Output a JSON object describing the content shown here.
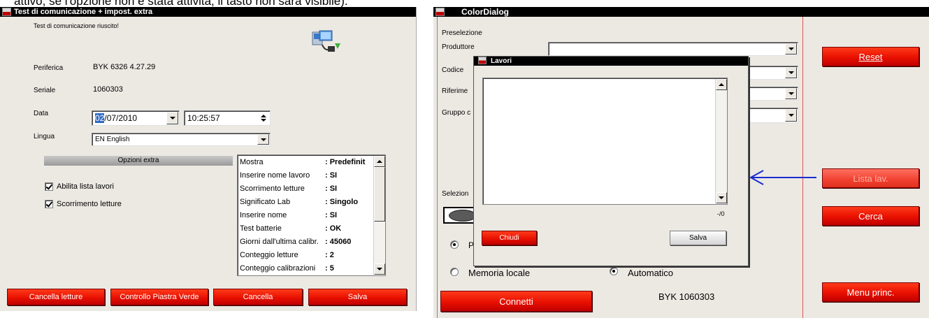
{
  "header_cut_text": "attivo, se l'opzione non è stata attivita, il tasto non sarà visibile).",
  "left": {
    "title": "Test di comunicazione + impost. extra",
    "success_msg": "Test di comunicazione riuscito!",
    "labels": {
      "periferica": "Periferica",
      "seriale": "Seriale",
      "data": "Data",
      "lingua": "Lingua"
    },
    "periferica_value": "BYK 6326 4.27.29",
    "seriale_value": "1060303",
    "date_day": "02",
    "date_rest": "/07/2010",
    "time_value": "10:25:57",
    "language_value": "EN English",
    "extra_header": "Opzioni extra",
    "checkbox_joblist": "Abilita lista lavori",
    "checkbox_scroll": "Scorrimento letture",
    "options": [
      {
        "k": "Mostra",
        "v": ": Predefinit"
      },
      {
        "k": "Inserire nome lavoro",
        "v": ": SI"
      },
      {
        "k": "Scorrimento letture",
        "v": ": SI"
      },
      {
        "k": "Significato Lab",
        "v": ": Singolo"
      },
      {
        "k": "Inserire nome",
        "v": ": SI"
      },
      {
        "k": "Test batterie",
        "v": ": OK"
      },
      {
        "k": "Giorni dall'ultima calibr.",
        "v": ": 45060"
      },
      {
        "k": "Conteggio letture",
        "v": ": 2"
      },
      {
        "k": "Conteggio calibrazioni",
        "v": ": 5"
      }
    ],
    "buttons": {
      "cancel_readings": "Cancella letture",
      "green_tile": "Controllo Piastra Verde",
      "cancel": "Cancella",
      "save": "Salva"
    }
  },
  "right": {
    "title": "ColorDialog",
    "preselezione": "Preselezione",
    "produttore": "Produttore",
    "codice": "Codice",
    "riferimento": "Riferime",
    "gruppo": "Gruppo c",
    "selezione": "Selezion",
    "radio_p": "P",
    "radio_memoria": "Memoria locale",
    "radio_automatico": "Automatico",
    "device": "BYK 1060303",
    "buttons": {
      "connetti": "Connetti",
      "reset": "Reset",
      "lista": "Lista lav.",
      "cerca": "Cerca",
      "menu": "Menu princ."
    },
    "arrow_color": "#1a2bd0"
  },
  "popup": {
    "title": "Lavori",
    "counter": "-/0",
    "close": "Chiudi",
    "save": "Salva"
  },
  "colors": {
    "accent_red": "#e81000",
    "titlebar": "#000000",
    "window_bg": "#ece9e3"
  }
}
